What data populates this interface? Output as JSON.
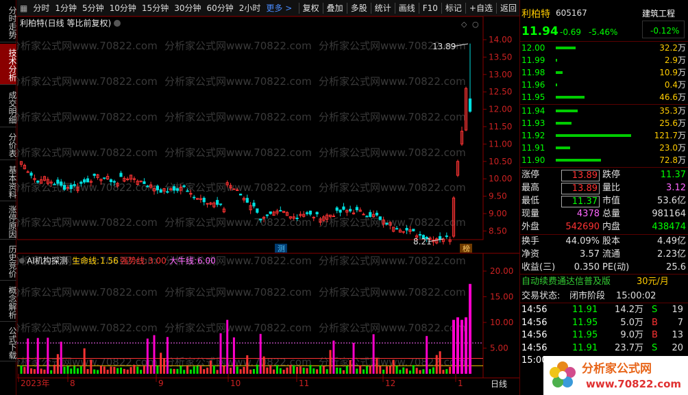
{
  "left_tabs": [
    {
      "label": "分时走势",
      "active": false
    },
    {
      "label": "技术分析",
      "active": true
    },
    {
      "label": "成交明细",
      "active": false
    },
    {
      "label": "分价表",
      "active": false
    },
    {
      "label": "基本资料",
      "active": false
    },
    {
      "label": "涨停原因",
      "active": false
    },
    {
      "label": "历史竞价",
      "active": false
    },
    {
      "label": "概念解析",
      "active": false
    },
    {
      "label": "公式下载",
      "active": false
    }
  ],
  "toolbar": {
    "periods": [
      "分时",
      "1分钟",
      "5分钟",
      "10分钟",
      "15分钟",
      "30分钟",
      "60分钟",
      "2小时"
    ],
    "more": "更多 >",
    "actions": [
      "复权",
      "叠加",
      "多股",
      "统计",
      "画线",
      "F10",
      "标记",
      "+自选",
      "返回"
    ]
  },
  "chart": {
    "title": "利柏特(日线 等比前复权)",
    "y_ticks": [
      "14.00",
      "13.50",
      "13.00",
      "12.50",
      "12.00",
      "11.50",
      "11.00",
      "10.50",
      "10.00",
      "9.50",
      "9.00",
      "8.50"
    ],
    "high_label": "13.89",
    "low_label": "8.21",
    "marker1": "测",
    "marker2": "榜",
    "indicator": {
      "name": "AI机构探测",
      "line1_label": "生命线:",
      "line1_value": "1.56",
      "line2_label": "强势线:",
      "line2_value": "3.00",
      "line3_label": "大牛线:",
      "line3_value": "6.00"
    },
    "ind_ticks": [
      "20.00",
      "15.00",
      "10.00",
      "5.00"
    ],
    "x_labels": [
      "2023年",
      "8",
      "9",
      "10",
      "11",
      "12",
      "1"
    ],
    "period_label": "日线",
    "watermark": "分析家公式网www.70822.com"
  },
  "quote": {
    "name": "利柏特",
    "code": "605167",
    "sector": "建筑工程",
    "sector_pct": "-0.12%",
    "price": "11.94",
    "change": "-0.69",
    "change_pct": "-5.46%",
    "asks": [
      {
        "price": "12.00",
        "vol": "32.2",
        "unit": "万",
        "ratio": 0.26
      },
      {
        "price": "11.99",
        "vol": "2.9",
        "unit": "万",
        "ratio": 0.02
      },
      {
        "price": "11.98",
        "vol": "10.9",
        "unit": "万",
        "ratio": 0.09
      },
      {
        "price": "11.96",
        "vol": "0.4",
        "unit": "万",
        "ratio": 0.01
      },
      {
        "price": "11.95",
        "vol": "46.6",
        "unit": "万",
        "ratio": 0.38
      }
    ],
    "bids": [
      {
        "price": "11.94",
        "vol": "35.3",
        "unit": "万",
        "ratio": 0.29
      },
      {
        "price": "11.93",
        "vol": "25.6",
        "unit": "万",
        "ratio": 0.21
      },
      {
        "price": "11.92",
        "vol": "121.7",
        "unit": "万",
        "ratio": 1.0
      },
      {
        "price": "11.91",
        "vol": "23.0",
        "unit": "万",
        "ratio": 0.19
      },
      {
        "price": "11.90",
        "vol": "72.8",
        "unit": "万",
        "ratio": 0.6
      }
    ],
    "stats": [
      {
        "l1": "涨停",
        "v1": "13.89",
        "c1": "red",
        "box1": true,
        "l2": "跌停",
        "v2": "11.37",
        "c2": "green"
      },
      {
        "l1": "最高",
        "v1": "13.89",
        "c1": "red",
        "box1": true,
        "l2": "量比",
        "v2": "3.12",
        "c2": "magenta"
      },
      {
        "l1": "最低",
        "v1": "11.37",
        "c1": "green",
        "box1": true,
        "l2": "市值",
        "v2": "53.6亿",
        "c2": "white"
      },
      {
        "l1": "现量",
        "v1": "4378",
        "c1": "magenta",
        "l2": "总量",
        "v2": "981164",
        "c2": "white"
      },
      {
        "l1": "外盘",
        "v1": "542690",
        "c1": "red",
        "l2": "内盘",
        "v2": "438474",
        "c2": "green"
      }
    ],
    "stats2": [
      {
        "l1": "换手",
        "v1": "44.09%",
        "c1": "white",
        "l2": "股本",
        "v2": "4.49亿",
        "c2": "white"
      },
      {
        "l1": "净资",
        "v1": "3.57",
        "c1": "white",
        "l2": "流通",
        "v2": "2.23亿",
        "c2": "white"
      },
      {
        "l1": "收益(三)",
        "v1": "0.350",
        "c1": "white",
        "l2": "PE(动)",
        "v2": "25.6",
        "c2": "white"
      }
    ],
    "promo": "自动续费通达信普及版",
    "promo_price": "30元/月",
    "trade_status_label": "交易状态:",
    "trade_status": "闭市阶段",
    "trade_time": "15:00:02",
    "ticks": [
      {
        "time": "14:56",
        "price": "11.91",
        "vol": "14.2万",
        "side": "S",
        "n": "19"
      },
      {
        "time": "14:56",
        "price": "11.95",
        "vol": "5.0万",
        "side": "B",
        "n": "7"
      },
      {
        "time": "14:56",
        "price": "11.95",
        "vol": "9.0万",
        "side": "B",
        "n": "13"
      },
      {
        "time": "14:56",
        "price": "11.91",
        "vol": "23.7万",
        "side": "S",
        "n": "20"
      },
      {
        "time": "15:00",
        "price": "",
        "vol": "",
        "side": "",
        "n": ""
      }
    ],
    "logo_text": "分析家公式网",
    "logo_url": "www.70822.com"
  }
}
